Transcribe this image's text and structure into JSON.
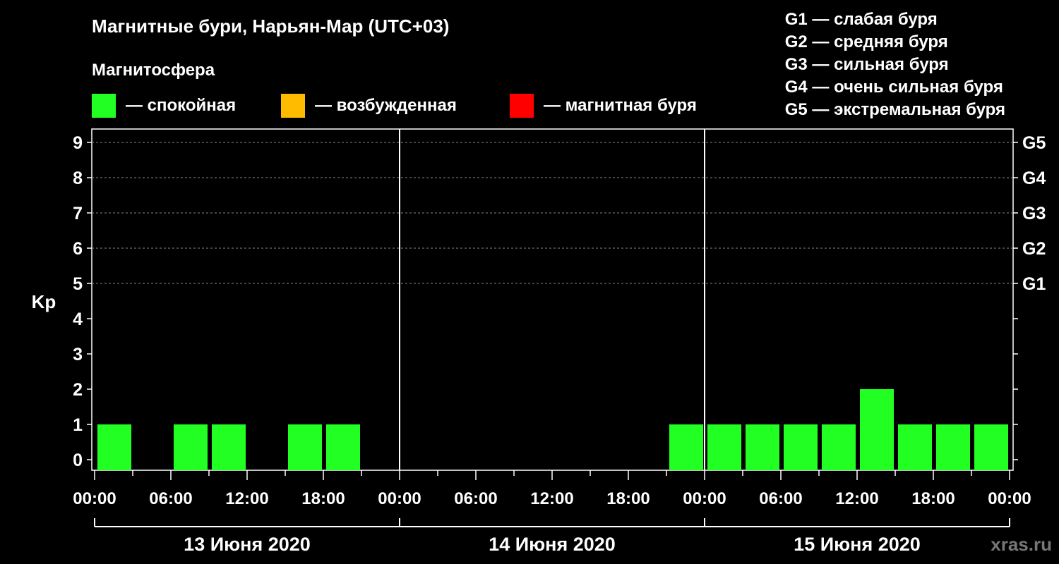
{
  "title": "Магнитные бури, Нарьян-Мар (UTC+03)",
  "legend": {
    "heading": "Магнитосфера",
    "items": [
      {
        "label": "— спокойная",
        "color": "#22ff22"
      },
      {
        "label": "— возбужденная",
        "color": "#ffbb00"
      },
      {
        "label": "— магнитная буря",
        "color": "#ff0000"
      }
    ]
  },
  "g_scale": [
    "G1 — слабая буря",
    "G2 — средняя буря",
    "G3 — сильная буря",
    "G4 — очень сильная буря",
    "G5 — экстремальная буря"
  ],
  "watermark": "xras.ru",
  "chart_data": {
    "type": "bar",
    "ylabel": "Kp",
    "ylim": [
      0,
      9
    ],
    "yticks": [
      "0",
      "1",
      "2",
      "3",
      "4",
      "5",
      "6",
      "7",
      "8",
      "9"
    ],
    "right_axis": [
      {
        "value": 5,
        "label": "G1"
      },
      {
        "value": 6,
        "label": "G2"
      },
      {
        "value": 7,
        "label": "G3"
      },
      {
        "value": 8,
        "label": "G4"
      },
      {
        "value": 9,
        "label": "G5"
      }
    ],
    "days": [
      "13 Июня 2020",
      "14 Июня 2020",
      "15 Июня 2020"
    ],
    "xtick_labels": [
      "00:00",
      "06:00",
      "12:00",
      "18:00",
      "00:00",
      "06:00",
      "12:00",
      "18:00",
      "00:00",
      "06:00",
      "12:00",
      "18:00",
      "00:00"
    ],
    "interval_hours": 3,
    "values": [
      1,
      0,
      1,
      1,
      0,
      1,
      1,
      0,
      0,
      0,
      0,
      0,
      0,
      0,
      0,
      1,
      1,
      1,
      1,
      1,
      2,
      1,
      1,
      1
    ],
    "bar_color": "#22ff22",
    "grid": "dashed horizontal at Kp 5–9"
  }
}
